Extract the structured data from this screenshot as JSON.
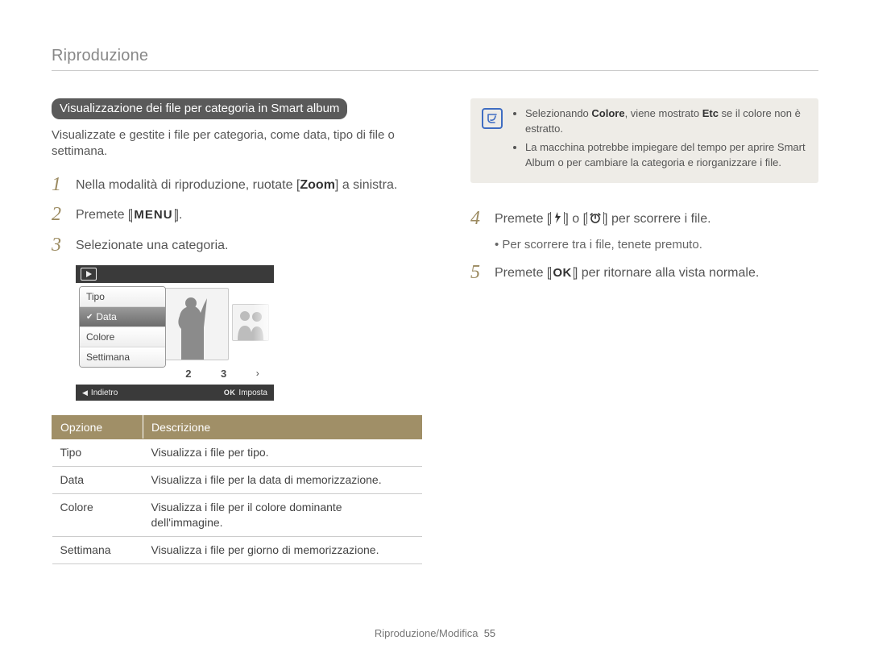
{
  "section_title": "Riproduzione",
  "left": {
    "pill": "Visualizzazione dei file per categoria in Smart album",
    "intro": "Visualizzate e gestite i file per categoria, come data, tipo di file o settimana.",
    "step1": {
      "num": "1",
      "pre": "Nella modalità di riproduzione, ruotate [",
      "bold": "Zoom",
      "post": "] a sinistra."
    },
    "step2": {
      "num": "2",
      "pre": "Premete [",
      "label": "MENU",
      "post": "]."
    },
    "step3": {
      "num": "3",
      "text": "Selezionate una categoria."
    },
    "device": {
      "panel": {
        "i0": "Tipo",
        "i1": "Data",
        "i2": "Colore",
        "i3": "Settimana"
      },
      "num2": "2",
      "num3": "3",
      "back_tri": "◀",
      "back": "Indietro",
      "ok": "OK",
      "set": "Imposta"
    },
    "table": {
      "h1": "Opzione",
      "h2": "Descrizione",
      "r1c1": "Tipo",
      "r1c2": "Visualizza i file per tipo.",
      "r2c1": "Data",
      "r2c2": "Visualizza i file per la data di memorizzazione.",
      "r3c1": "Colore",
      "r3c2": "Visualizza i file per il colore dominante dell'immagine.",
      "r4c1": "Settimana",
      "r4c2": "Visualizza i file per giorno di memorizzazione."
    }
  },
  "right": {
    "note1_pre": "Selezionando ",
    "note1_b1": "Colore",
    "note1_mid": ", viene mostrato ",
    "note1_b2": "Etc",
    "note1_post": " se il colore non è estratto.",
    "note2": "La macchina potrebbe impiegare del tempo per aprire Smart Album o per cambiare la categoria e riorganizzare i file.",
    "step4": {
      "num": "4",
      "pre": "Premete [",
      "mid": "] o [",
      "post": "] per scorrere i file."
    },
    "sub4": "•  Per scorrere tra i file, tenete premuto.",
    "step5": {
      "num": "5",
      "pre": "Premete [",
      "label": "OK",
      "post": "] per ritornare alla vista normale."
    }
  },
  "footer": {
    "text": "Riproduzione/Modifica",
    "page": "55"
  }
}
